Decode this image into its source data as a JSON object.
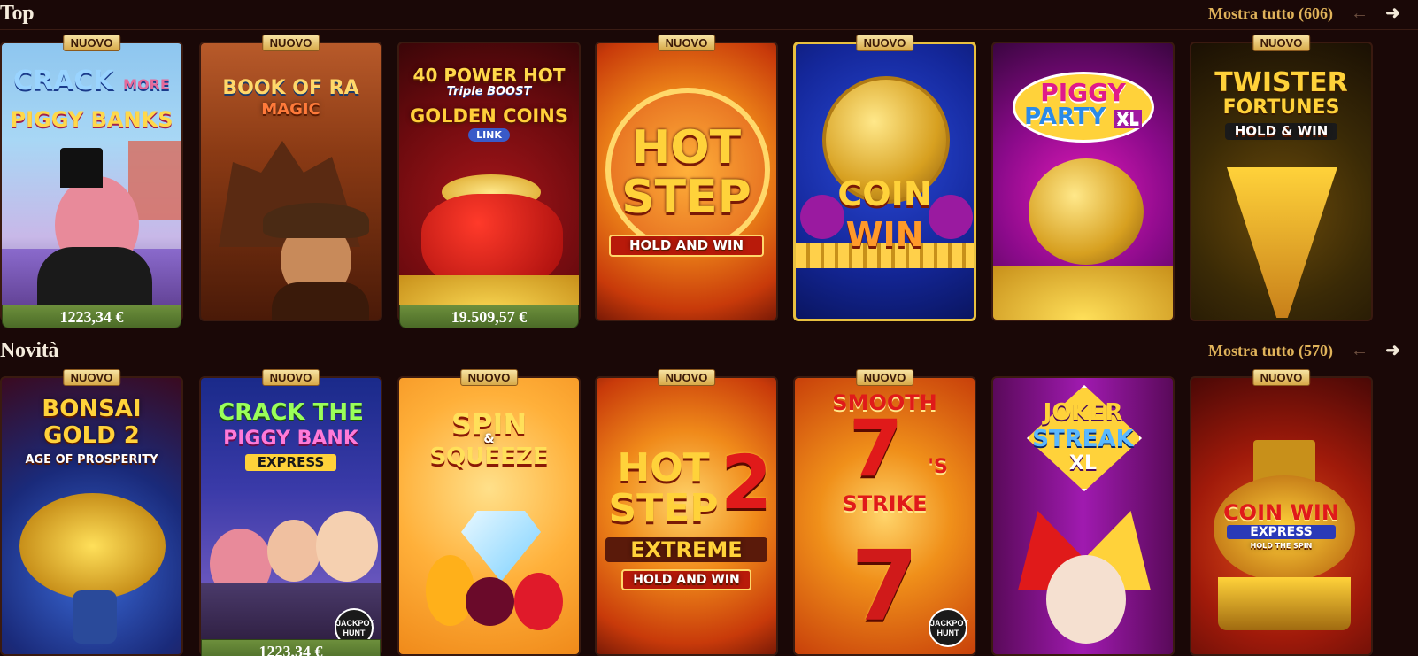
{
  "sections": {
    "top": {
      "title": "Top",
      "show_all": "Mostra tutto (606)",
      "games": [
        {
          "name": "CRACK MORE PIGGY BANKS",
          "badge": "NUOVO",
          "jackpot": "1223,34 €"
        },
        {
          "name": "BOOK OF RA MAGIC",
          "badge": "NUOVO"
        },
        {
          "name": "40 POWER HOT Triple BOOST GOLDEN COINS LINK",
          "jackpot": "19.509,57 €"
        },
        {
          "name": "HOT STEP HOLD AND WIN",
          "badge": "NUOVO"
        },
        {
          "name": "COIN WIN",
          "badge": "NUOVO"
        },
        {
          "name": "PIGGY PARTY XL"
        },
        {
          "name": "TWISTER FORTUNES HOLD & WIN",
          "badge": "NUOVO"
        }
      ]
    },
    "new": {
      "title": "Novità",
      "show_all": "Mostra tutto (570)",
      "games": [
        {
          "name": "BONSAI GOLD 2 AGE OF PROSPERITY",
          "badge": "NUOVO"
        },
        {
          "name": "CRACK THE PIGGY BANK EXPRESS",
          "badge": "NUOVO",
          "jackpot": "1223,34 €"
        },
        {
          "name": "SPIN & SQUEEZE",
          "badge": "NUOVO"
        },
        {
          "name": "HOT STEP 2 EXTREME HOLD AND WIN",
          "badge": "NUOVO"
        },
        {
          "name": "SMOOTH 7's STRIKE",
          "badge": "NUOVO"
        },
        {
          "name": "JOKER STREAK XL"
        },
        {
          "name": "COIN WIN EXPRESS HOLD THE SPIN",
          "badge": "NUOVO"
        }
      ]
    }
  },
  "logos": {
    "crack_more": [
      "CRACK",
      "MORE",
      "PIGGY BANKS"
    ],
    "book_of_ra": [
      "BOOK OF RA",
      "MAGIC"
    ],
    "power_hot": [
      "40 POWER HOT",
      "Triple BOOST",
      "GOLDEN COINS",
      "LINK"
    ],
    "hot_step": [
      "HOT",
      "STEP",
      "HOLD AND WIN"
    ],
    "coin_win": [
      "COIN",
      "WIN"
    ],
    "piggy_party": [
      "PIGGY",
      "PARTY",
      "XL"
    ],
    "twister": [
      "TWISTER",
      "FORTUNES",
      "HOLD & WIN"
    ],
    "bonsai": [
      "BONSAI",
      "GOLD 2",
      "AGE OF PROSPERITY"
    ],
    "crack_the": [
      "CRACK THE",
      "PIGGY BANK",
      "EXPRESS"
    ],
    "spin_squeeze": [
      "SPIN",
      "&",
      "SQUEEZE"
    ],
    "hot_step2": [
      "HOT",
      "STEP",
      "2",
      "EXTREME",
      "HOLD AND WIN"
    ],
    "smooth7": [
      "SMOOTH",
      "7",
      "'S",
      "STRIKE"
    ],
    "joker": [
      "JOKER",
      "STREAK",
      "XL"
    ],
    "coinwin_express": [
      "COIN WIN",
      "EXPRESS",
      "HOLD THE SPIN"
    ]
  },
  "jackpot_hunt_badge": [
    "JACKPOT",
    "HUNT"
  ],
  "icons": {
    "prev": "arrow-left-icon",
    "next": "arrow-right-icon"
  },
  "colors": {
    "background": "#1a0807",
    "accent": "#e0b35a",
    "badge": "#d7a948",
    "jackpot_bar": "#5b7d30"
  }
}
